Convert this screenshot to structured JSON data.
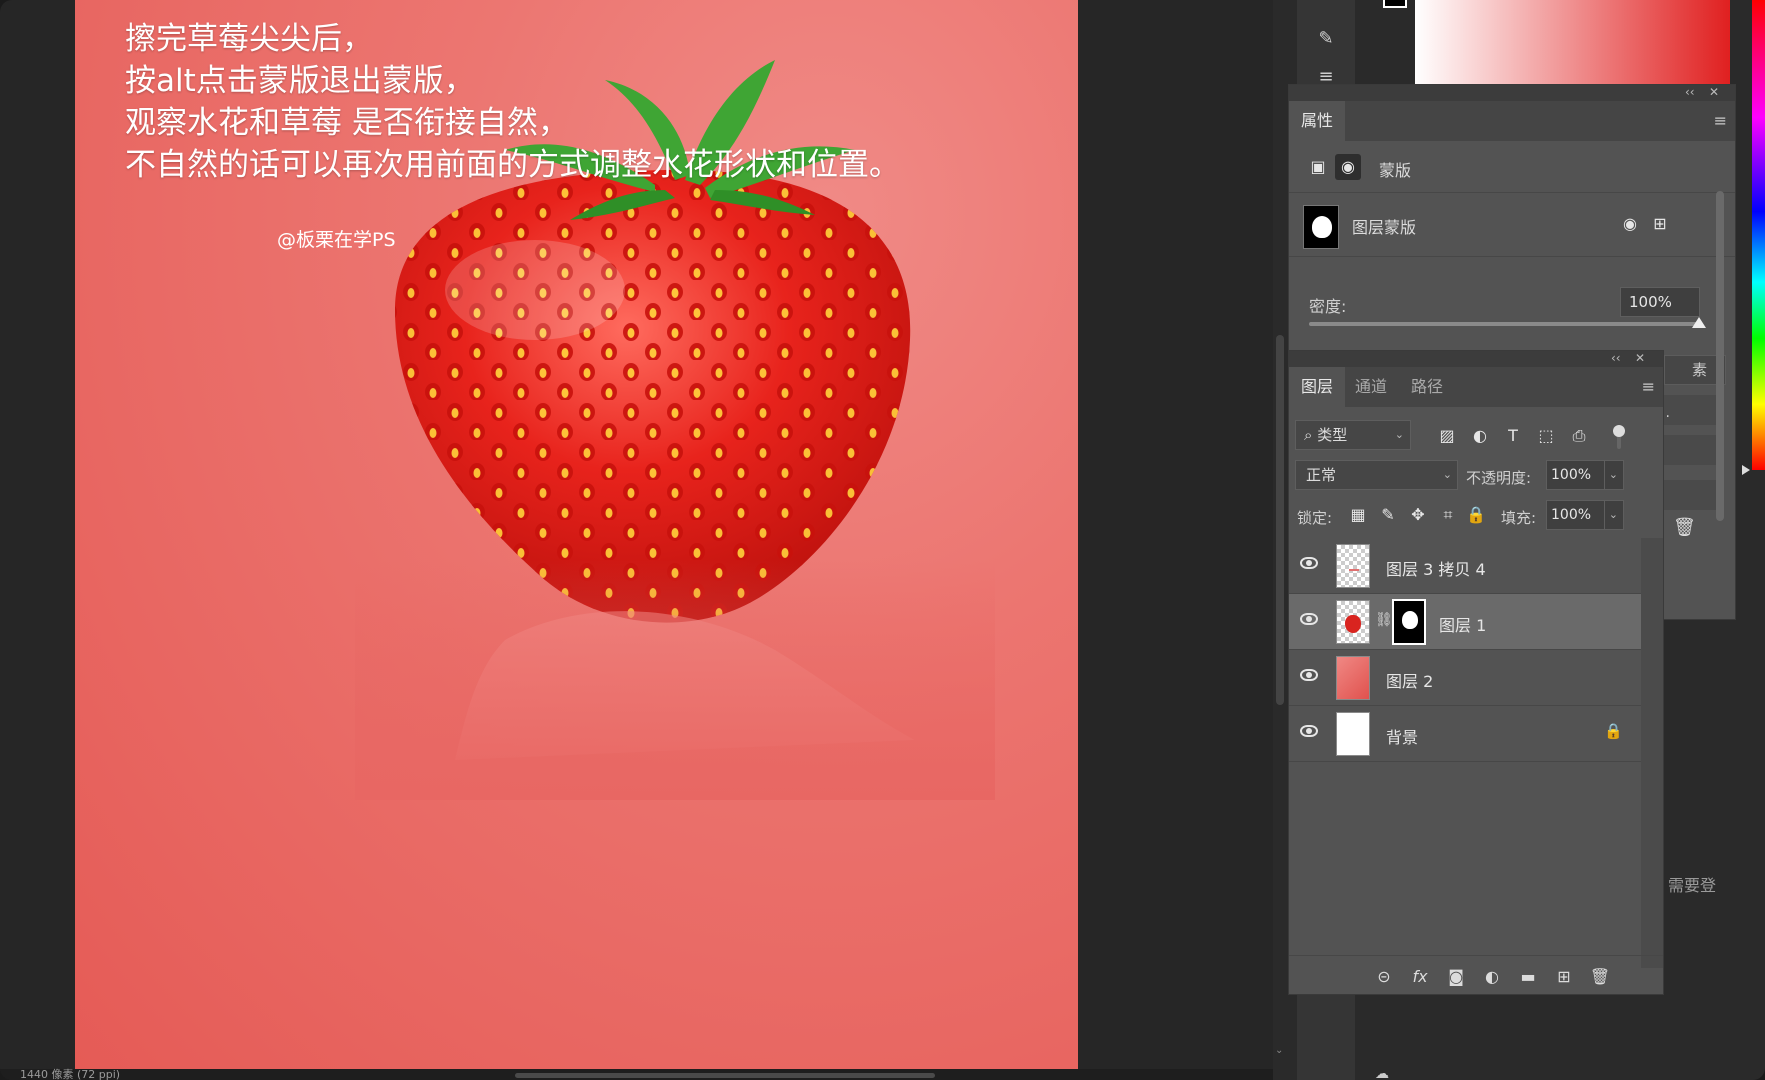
{
  "canvas": {
    "caption_lines": [
      "擦完草莓尖尖后，",
      "按alt点击蒙版退出蒙版，",
      "观察水花和草莓 是否衔接自然，",
      "不自然的话可以再次用前面的方式调整水花形状和位置。"
    ],
    "watermark": "@板栗在学PS",
    "status_text": "1440 像素 (72 ppi)",
    "background_color": "#e86763"
  },
  "properties_panel": {
    "tab_label": "属性",
    "kind_label": "蒙版",
    "mask_name": "图层蒙版",
    "density_label": "密度:",
    "density_value": "100%",
    "partial_button_label": "素",
    "ellipsis": "..",
    "collapse_glyph": "‹‹",
    "close_glyph": "✕"
  },
  "layers_panel": {
    "tabs": [
      "图层",
      "通道",
      "路径"
    ],
    "filter_label": "类型",
    "blend_mode": "正常",
    "opacity_label": "不透明度:",
    "opacity_value": "100%",
    "lock_label": "锁定:",
    "fill_label": "填充:",
    "fill_value": "100%",
    "layers": [
      {
        "name": "图层 3 拷贝 4",
        "visible": true,
        "selected": false
      },
      {
        "name": "图层 1",
        "visible": true,
        "selected": true
      },
      {
        "name": "图层 2",
        "visible": true,
        "selected": false
      },
      {
        "name": "背景",
        "visible": true,
        "selected": false,
        "locked": true
      }
    ],
    "collapse_glyph": "‹‹",
    "close_glyph": "✕"
  },
  "workspace": {
    "login_hint": "需要登"
  },
  "icons": {
    "search": "search-icon",
    "pixel_filter": "image-icon",
    "adjustment_filter": "half-circle-icon",
    "type_filter": "type-icon",
    "shape_filter": "shape-icon",
    "smart_filter": "smart-object-icon",
    "lock_pixels": "checker-icon",
    "lock_paint": "brush-icon",
    "lock_move": "move-icon",
    "lock_artboard": "crop-icon",
    "lock_all": "lock-icon"
  },
  "colors": {
    "panel_bg": "#535353",
    "selected_layer_bg": "#6a6a6a",
    "accent_red": "#e0524e"
  }
}
